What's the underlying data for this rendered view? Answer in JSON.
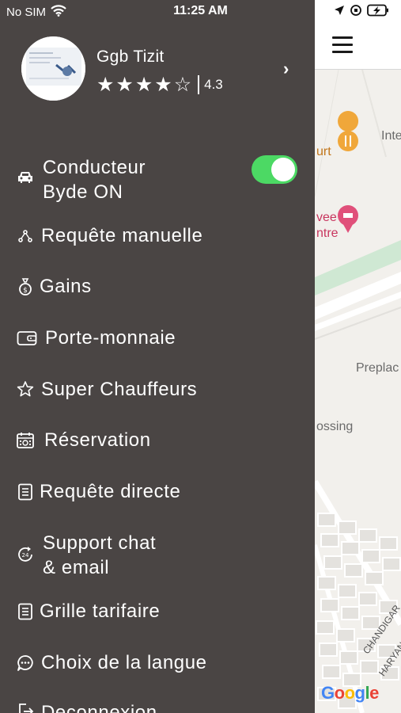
{
  "status_bar": {
    "carrier": "No SIM",
    "time": "11:25 AM"
  },
  "profile": {
    "name": "Ggb Tizit",
    "rating_value": "4.3",
    "stars_filled": 4,
    "stars_total": 5
  },
  "menu": {
    "driver_line1": "Conducteur",
    "driver_line2": "Byde ON",
    "driver_toggle_on": true,
    "manual_request": "Requête manuelle",
    "earnings": "Gains",
    "wallet": "Porte-monnaie",
    "super_drivers": "Super Chauffeurs",
    "reservation": "Réservation",
    "direct_request": "Requête directe",
    "support_line1": "Support chat",
    "support_line2": "& email",
    "fare_grid": "Grille tarifaire",
    "language": "Choix de la langue",
    "logout": "Deconnexion"
  },
  "map": {
    "label_inte": "Inte",
    "label_urt": "urt",
    "label_vee": "vee",
    "label_ntre": "ntre",
    "label_preplac": "Preplac",
    "label_ossing": "ossing",
    "label_chandigarh": "CHANDIGAR",
    "label_haryana": "HARYAN",
    "google_logo": "Google"
  },
  "colors": {
    "drawer_bg": "#4a4544",
    "toggle_on": "#4cd964",
    "map_bg": "#f2f0ec"
  }
}
